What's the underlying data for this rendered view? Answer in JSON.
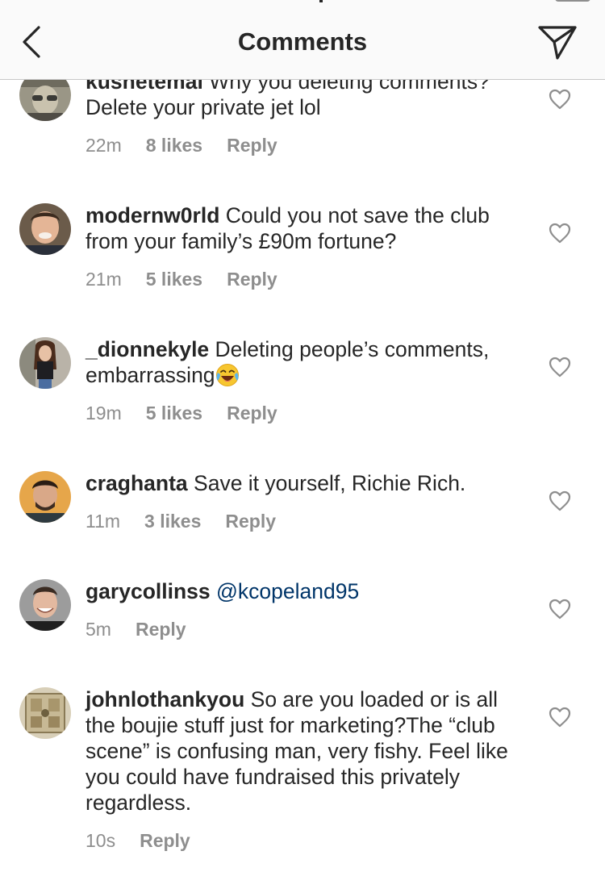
{
  "header": {
    "title": "Comments",
    "back_icon": "chevron-left-icon",
    "send_icon": "paper-plane-icon"
  },
  "comments": [
    {
      "username": "kushetemal",
      "text": "Why you deleting comments? Delete your private jet lol",
      "time": "22m",
      "likes": "8 likes",
      "reply": "Reply"
    },
    {
      "username": "modernw0rld",
      "text": "Could you not save the club from your family’s £90m fortune?",
      "time": "21m",
      "likes": "5 likes",
      "reply": "Reply"
    },
    {
      "username": "_dionnekyle",
      "text": "Deleting people’s comments, embarrassing",
      "emoji": "😂",
      "time": "19m",
      "likes": "5 likes",
      "reply": "Reply"
    },
    {
      "username": "craghanta",
      "text": "Save it yourself, Richie Rich.",
      "time": "11m",
      "likes": "3 likes",
      "reply": "Reply"
    },
    {
      "username": "garycollinss",
      "mention": "@kcopeland95",
      "time": "5m",
      "reply": "Reply"
    },
    {
      "username": "johnlothankyou",
      "text": "So are you loaded or is all the boujie stuff just for marketing?The “club scene” is confusing man, very fishy.  Feel like you could have fundraised this privately regardless.",
      "time": "10s",
      "reply": "Reply"
    }
  ],
  "colors": {
    "text": "#262626",
    "secondary": "#8e8e8e",
    "mention": "#003569",
    "header_bg": "#fafafa"
  }
}
